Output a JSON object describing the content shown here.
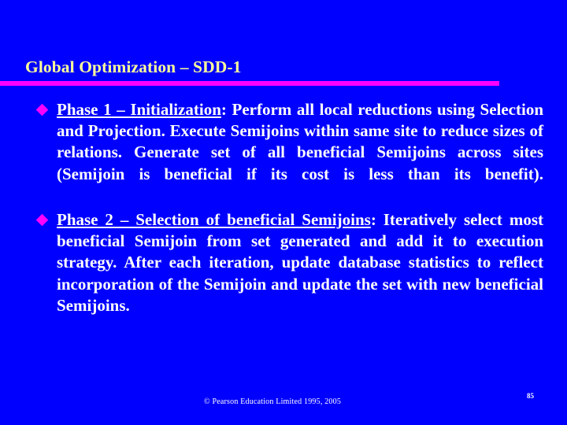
{
  "slide": {
    "background_color": "#0000FF",
    "title": "Global Optimization – SDD-1",
    "title_color": "#FFFF99",
    "rule_color": "#FF00FF",
    "body_text_color": "#FFFFFF",
    "bullet_glyph": "diamond-bullet",
    "bullet_color": "#FF00FF"
  },
  "bullets": [
    {
      "heading": "Phase  1  –  Initialization",
      "heading_underlined": true,
      "separator": ": ",
      "body": "Perform all local reductions using Selection and Projection. Execute Semijoins within same site to reduce sizes of relations. Generate set of all beneficial Semijoins across sites (Semijoin is beneficial if its cost is less than its benefit)."
    },
    {
      "heading": "Phase  2  –  Selection  of  beneficial  Semijoins",
      "heading_underlined": true,
      "separator": ": ",
      "body": "Iteratively select most beneficial Semijoin from set generated and add it to execution strategy. After each iteration, update database statistics to reflect incorporation of the Semijoin and update the set with new beneficial Semijoins."
    }
  ],
  "footer": {
    "copyright": "© Pearson Education Limited 1995, 2005",
    "page_number": "85"
  }
}
